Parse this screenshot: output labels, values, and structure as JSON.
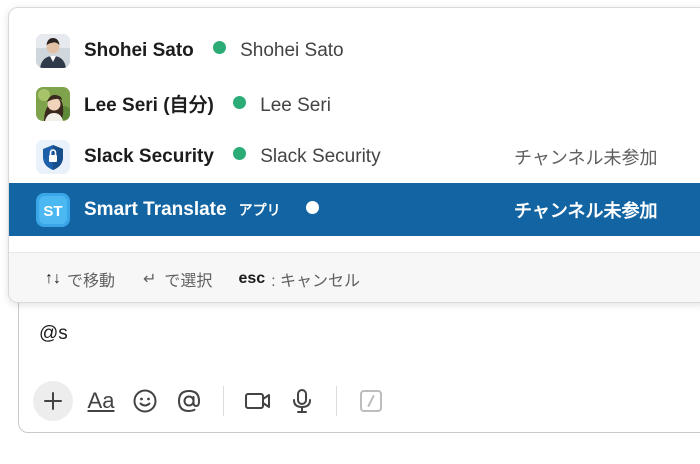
{
  "composer": {
    "text": "@s"
  },
  "toolbar": {
    "items": [
      {
        "icon": "plus-icon"
      },
      {
        "icon": "text-format-icon",
        "label": "Aa"
      },
      {
        "icon": "emoji-icon"
      },
      {
        "icon": "mention-icon"
      },
      {
        "icon": "video-icon"
      },
      {
        "icon": "microphone-icon"
      },
      {
        "icon": "slash-command-icon"
      }
    ]
  },
  "mentions": {
    "items": [
      {
        "name": "Shohei Sato",
        "full_name": "Shohei Sato",
        "status": "online",
        "hint": ""
      },
      {
        "name": "Lee Seri (自分)",
        "full_name": "Lee Seri",
        "status": "online",
        "hint": ""
      },
      {
        "name": "Slack Security",
        "full_name": "Slack Security",
        "status": "online",
        "hint": "チャンネル未参加"
      },
      {
        "name": "Smart Translate",
        "badge": "アプリ",
        "status": "online",
        "hint": "チャンネル未参加",
        "selected": true
      }
    ],
    "footer": {
      "move_arrows": "↑↓",
      "move_label": "で移動",
      "select_symbol": "↵",
      "select_label": "で選択",
      "cancel_key": "esc",
      "cancel_label": ": キャンセル"
    }
  },
  "colors": {
    "selected_bg": "#1264a3",
    "online": "#2bac76"
  }
}
